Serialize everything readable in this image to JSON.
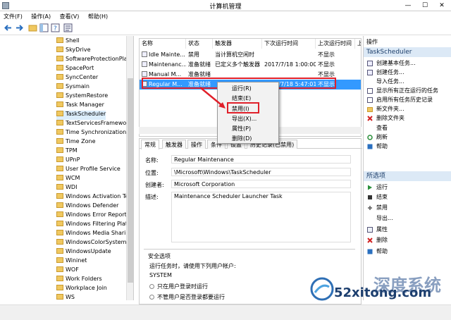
{
  "window": {
    "title": "计算机管理",
    "minimize": "—",
    "maximize": "☐",
    "close": "✕"
  },
  "menu": [
    "文件(F)",
    "操作(A)",
    "查看(V)",
    "帮助(H)"
  ],
  "tree": {
    "items": [
      "Shell",
      "SkyDrive",
      "SoftwareProtectionPlatf",
      "SpacePort",
      "SyncCenter",
      "Sysmain",
      "SystemRestore",
      "Task Manager",
      "TaskScheduler",
      "TextServicesFramework",
      "Time Synchronization",
      "Time Zone",
      "TPM",
      "UPnP",
      "User Profile Service",
      "WCM",
      "WDI",
      "Windows Activation Tec",
      "Windows Defender",
      "Windows Error Reporti",
      "Windows Filtering Platf",
      "Windows Media Sharin",
      "WindowsColorSystem",
      "WindowsUpdate",
      "Wininet",
      "WOF",
      "Work Folders",
      "Workplace Join",
      "WS"
    ],
    "selected_index": 8
  },
  "tasklist": {
    "columns": [
      "名称",
      "状态",
      "触发器",
      "下次运行时间",
      "上次运行时间",
      "上"
    ],
    "rows": [
      {
        "name": "Idle Mainte...",
        "status": "禁用",
        "trigger": "当计算机空闲时",
        "next": "",
        "last": "不显示"
      },
      {
        "name": "Maintenanc...",
        "status": "准备就绪",
        "trigger": "已定义多个触发器",
        "next": "2017/7/18 1:00:00",
        "last": "不显示"
      },
      {
        "name": "Manual M...",
        "status": "准备就绪",
        "trigger": "",
        "next": "",
        "last": "不显示"
      },
      {
        "name": "Regular M...",
        "status": "准备就绪",
        "trigger": "",
        "next": "2017/7/18 5:47:01",
        "last": "不显示"
      }
    ],
    "selected_index": 3
  },
  "context_menu": {
    "items": [
      "运行(R)",
      "结束(E)",
      "禁用(I)",
      "导出(X)...",
      "属性(P)",
      "删除(D)"
    ],
    "highlighted": "禁用(I)"
  },
  "detail": {
    "tabs": [
      "常规",
      "触发器",
      "操作",
      "条件",
      "设置",
      "历史记录(已禁用)"
    ],
    "fields": {
      "name_label": "名称:",
      "name_value": "Regular Maintenance",
      "location_label": "位置:",
      "location_value": "\\Microsoft\\Windows\\TaskScheduler",
      "author_label": "创建者:",
      "author_value": "Microsoft Corporation",
      "desc_label": "描述:",
      "desc_value": "Maintenance Scheduler Launcher Task"
    },
    "security": {
      "header": "安全选项",
      "run_as_label": "运行任务时，请使用下列用户帐户:",
      "account": "SYSTEM",
      "option1": "只在用户登录时运行",
      "option2": "不管用户是否登录都要运行"
    }
  },
  "actions": {
    "header": "操作",
    "group1": "TaskScheduler",
    "group1_items": [
      "创建基本任务...",
      "创建任务...",
      "导入任务...",
      "显示所有正在运行的任务",
      "启用所有任务历史记录",
      "新文件夹...",
      "删除文件夹",
      "查看",
      "刷新",
      "帮助"
    ],
    "group2": "所选项",
    "group2_items": [
      "运行",
      "结束",
      "禁用",
      "导出...",
      "属性",
      "删除",
      "帮助"
    ]
  },
  "watermark": {
    "text": "52xitong.com",
    "cn": "深度系统"
  },
  "colors": {
    "selection": "#3399ff",
    "highlight_box": "#e0202a",
    "group_bg": "#dce9f6"
  }
}
